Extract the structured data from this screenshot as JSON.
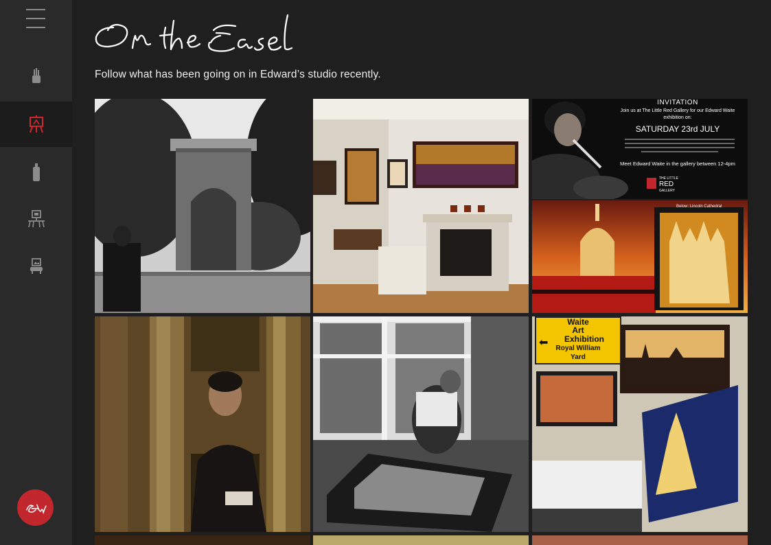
{
  "page": {
    "heading": "On the Easel",
    "intro": "Follow what has been going on in Edward’s studio recently."
  },
  "sidebar": {
    "menu_icon": "hamburger-icon",
    "items": [
      {
        "icon": "brushes-icon",
        "active": false
      },
      {
        "icon": "easel-icon",
        "active": true
      },
      {
        "icon": "paint-tube-icon",
        "active": false
      },
      {
        "icon": "exhibition-icon",
        "active": false
      },
      {
        "icon": "gallery-icon",
        "active": false
      }
    ],
    "logo_icon": "edward-waite-signature-logo"
  },
  "invitation": {
    "title": "INVITATION",
    "line1": "Join us at The Little Red Gallery for our Edward Waite",
    "line2": "exhibition on:",
    "date": "SATURDAY 23rd JULY",
    "meet": "Meet Edward Waite in the gallery between 12-4pm",
    "gallery_top": "THE LITTLE",
    "gallery_mid": "RED",
    "gallery_bot": "GALLERY"
  },
  "lincoln_caption": "Below: Lincoln Cathedral",
  "sign": {
    "line1": "Waite",
    "line2": "Art",
    "line3": "Exhibition",
    "line4": "Royal William",
    "line5": "Yard"
  },
  "colors": {
    "brand_red": "#c1272d",
    "sidebar_bg": "#2a2a2a",
    "main_bg": "#1f1f1f",
    "active_icon": "#d0282e",
    "inactive_icon": "#8c8c8c"
  }
}
